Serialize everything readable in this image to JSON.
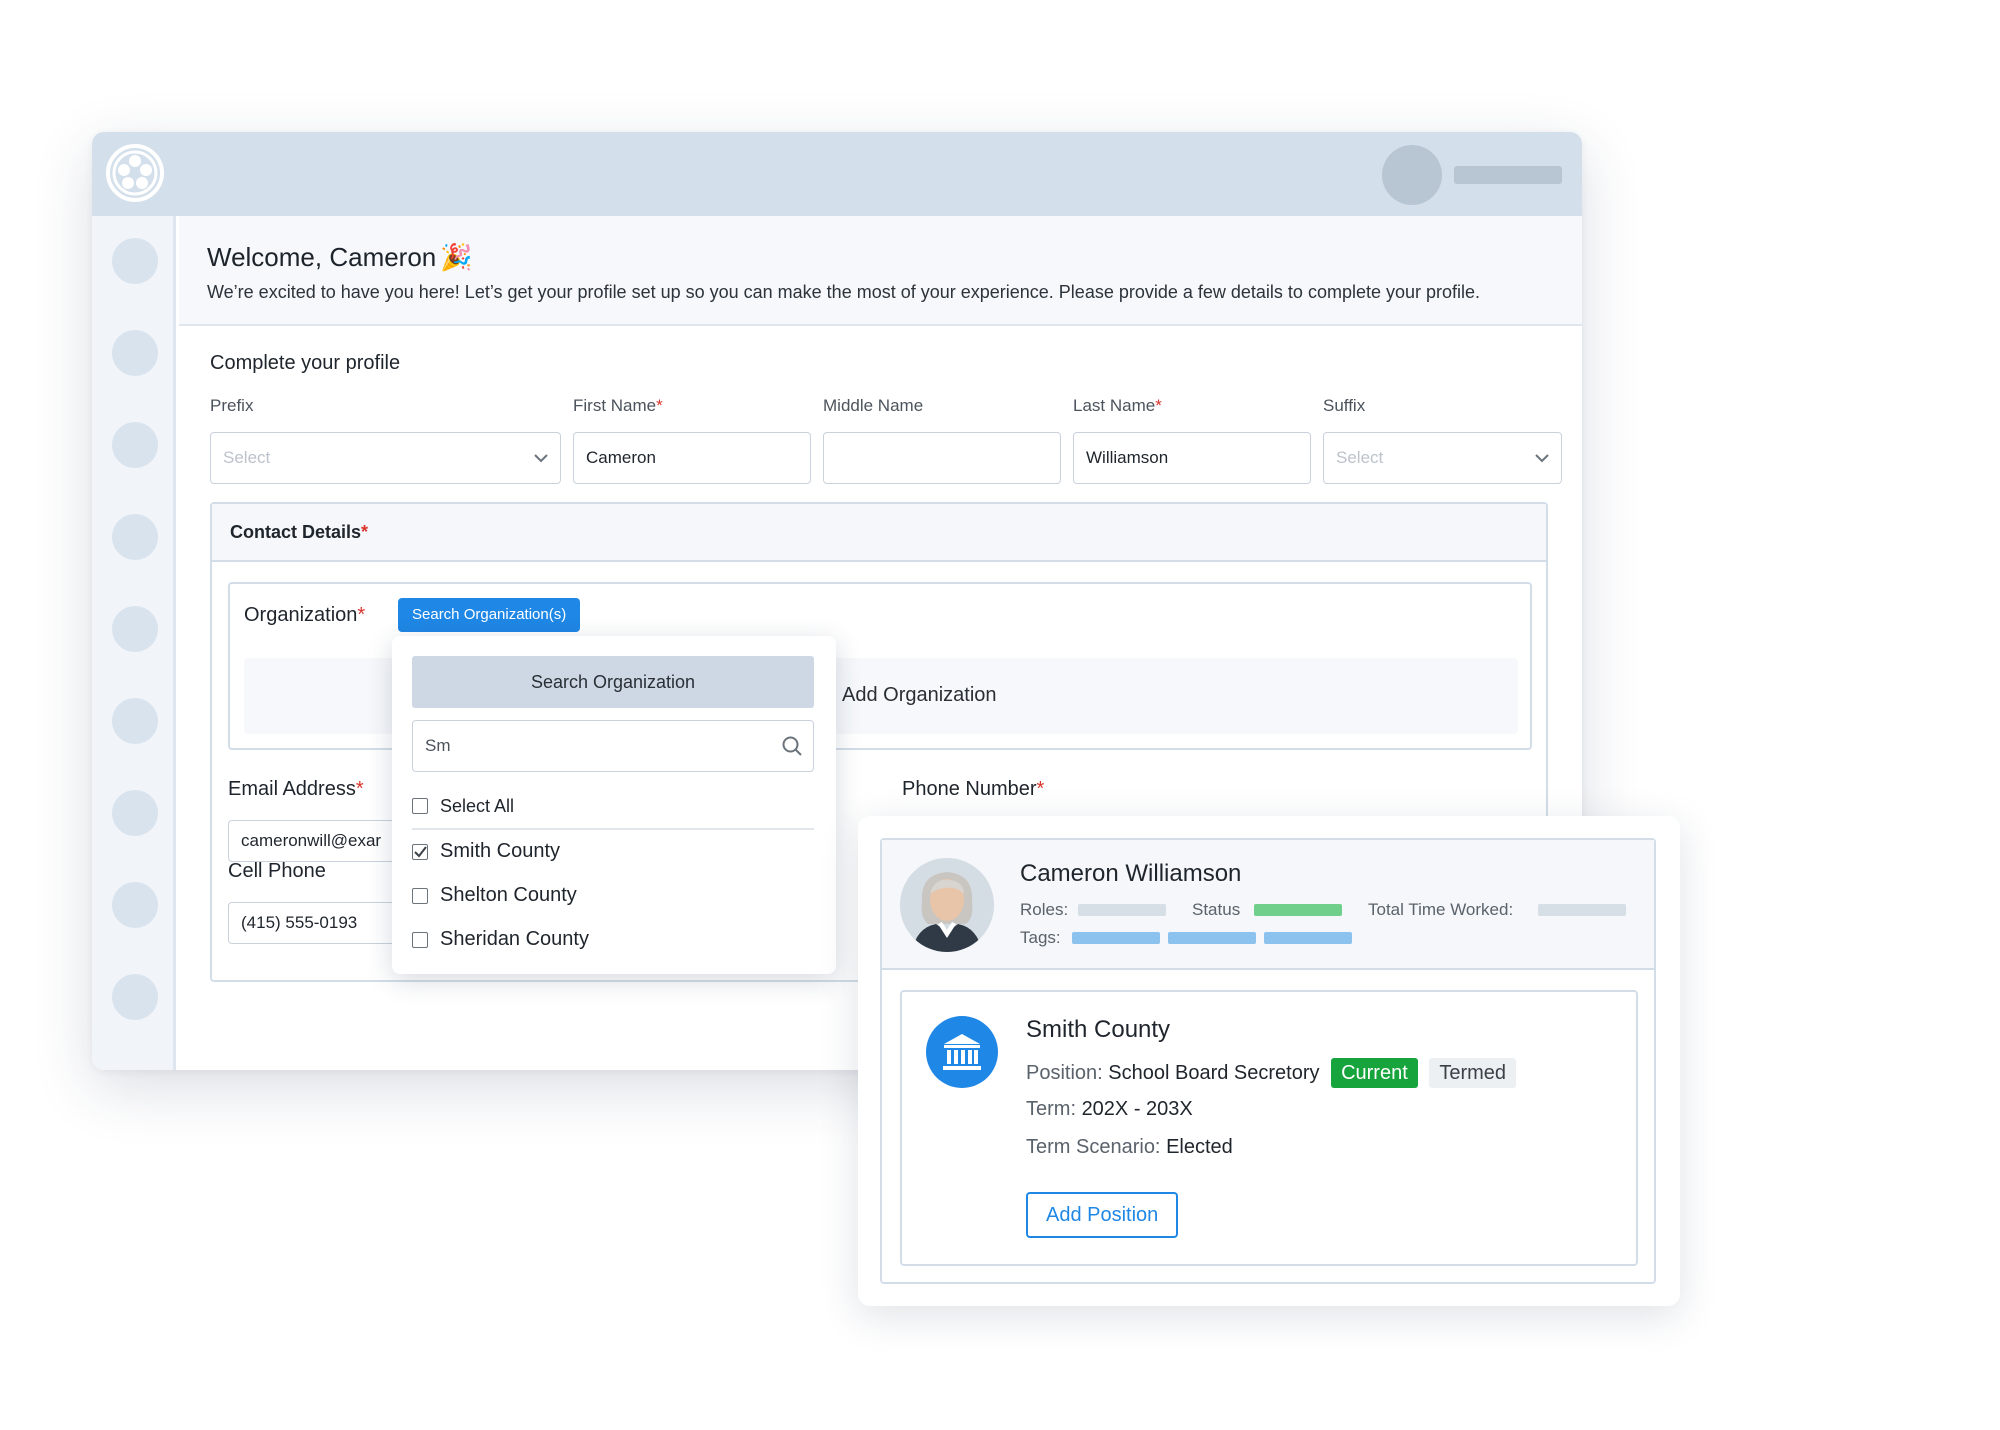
{
  "header": {
    "logo_icon": "film-reel-logo-icon",
    "avatar_icon": "user-avatar-placeholder"
  },
  "sidebar": {
    "item_count": 9,
    "item_icon": "nav-placeholder-circle"
  },
  "welcome": {
    "title": "Welcome, Cameron",
    "emoji": "🎉",
    "message": "We’re excited to have you here! Let’s get your profile set up so you can make the most of your experience. Please provide a few details to complete your profile."
  },
  "profile_form": {
    "section_title": "Complete your profile",
    "required_mark": "*",
    "prefix": {
      "label": "Prefix",
      "placeholder": "Select"
    },
    "first_name": {
      "label": "First Name",
      "value": "Cameron"
    },
    "middle_name": {
      "label": "Middle Name",
      "value": ""
    },
    "last_name": {
      "label": "Last Name",
      "value": "Williamson"
    },
    "suffix": {
      "label": "Suffix",
      "placeholder": "Select"
    }
  },
  "contact_details": {
    "title": "Contact Details",
    "organization_label": "Organization",
    "search_button": "Search Organization(s)",
    "add_organization": "Add Organization",
    "email_label": "Email Address",
    "email_value": "cameronwill@exar",
    "phone_label": "Phone Number",
    "cell_label": "Cell Phone",
    "cell_value": "(415) 555-0193"
  },
  "org_dropdown": {
    "header": "Search Organization",
    "search_value": "Sm",
    "options": [
      {
        "label": "Select All",
        "checked": false
      },
      {
        "label": "Smith County",
        "checked": true
      },
      {
        "label": "Shelton County",
        "checked": false
      },
      {
        "label": "Sheridan County",
        "checked": false
      }
    ]
  },
  "profile_card": {
    "name": "Cameron Williamson",
    "roles_label": "Roles:",
    "status_label": "Status",
    "total_time_label": "Total Time Worked:",
    "tags_label": "Tags:",
    "status_color": "#6fcf8b",
    "tag_color": "#8cc3ee",
    "placeholder_color": "#d6dee6",
    "organization": {
      "name": "Smith County",
      "icon": "government-building-icon",
      "position_label": "Position:",
      "position_value": "School Board Secretory",
      "badge_current": "Current",
      "badge_termed": "Termed",
      "term_label": "Term:",
      "term_value": "202X - 203X",
      "scenario_label": "Term Scenario:",
      "scenario_value": "Elected",
      "add_position_button": "Add Position"
    }
  },
  "colors": {
    "accent": "#1f87e5",
    "topbar": "#d3dfea",
    "success": "#18a43c",
    "required": "#d9342b"
  }
}
